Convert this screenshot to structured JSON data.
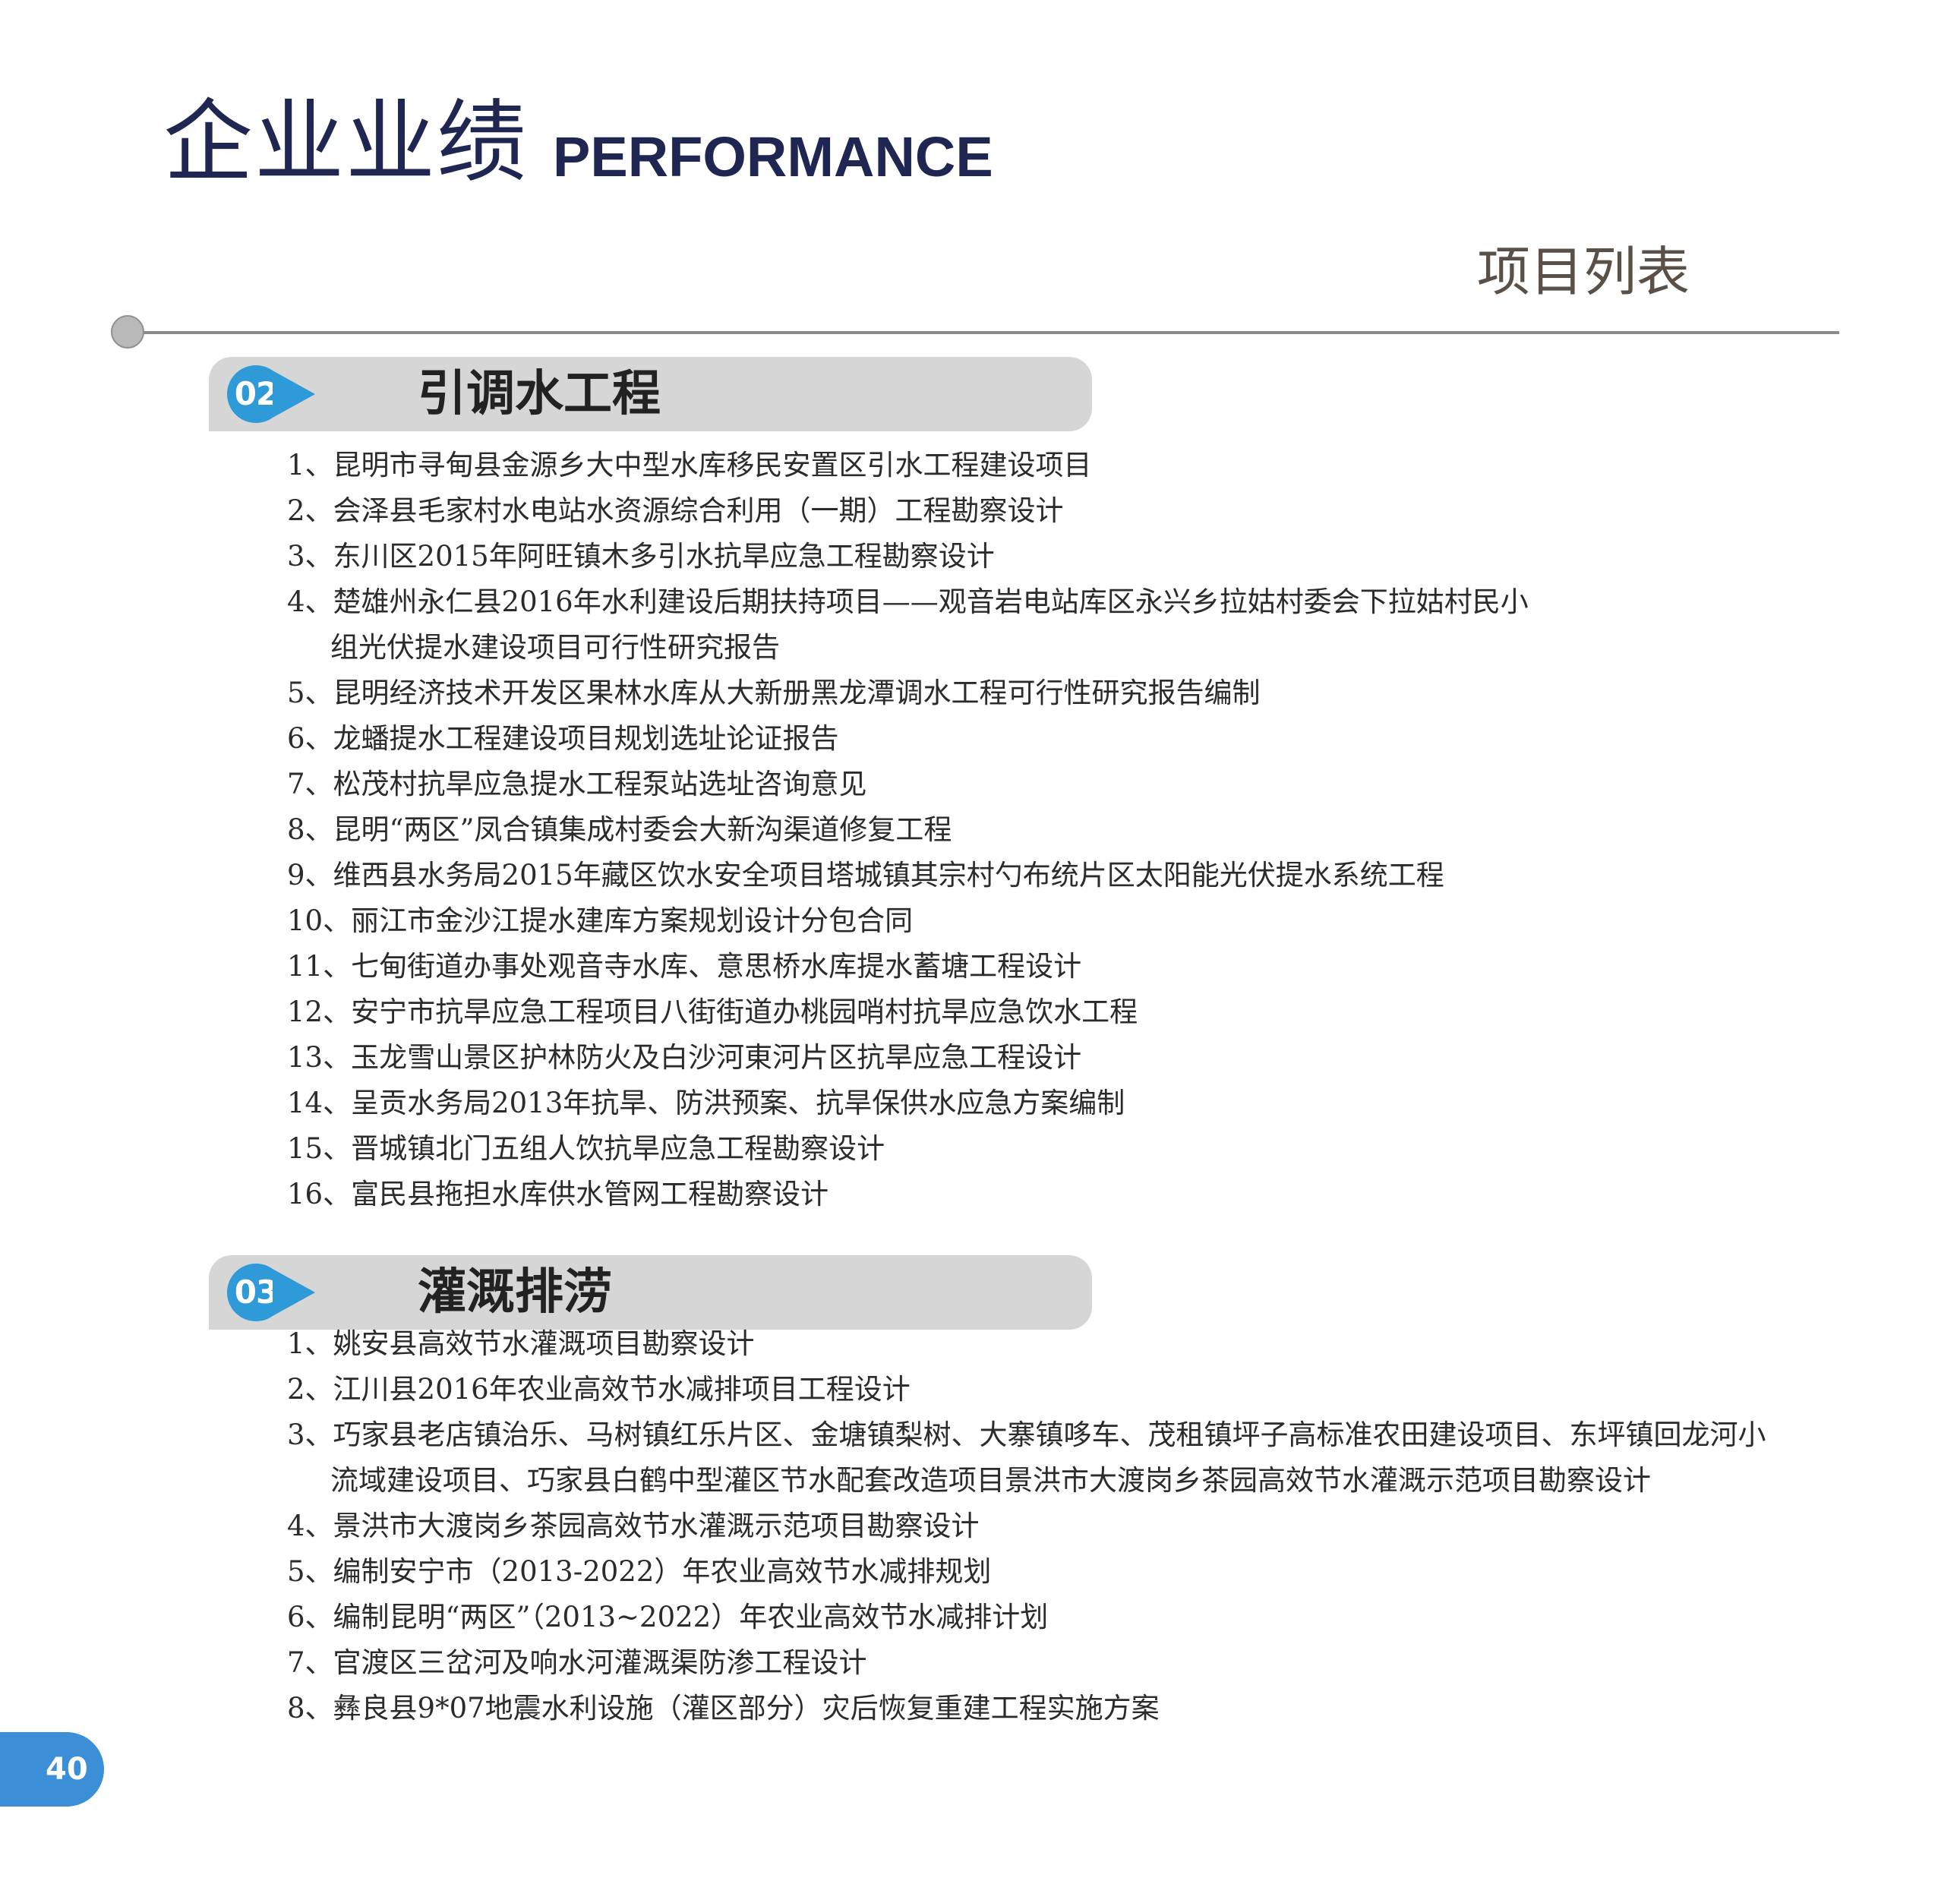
{
  "header": {
    "title_cn": "企业业绩",
    "title_en": "PERFORMANCE",
    "subtitle": "项目列表"
  },
  "sections": [
    {
      "badge": "02",
      "title": "引调水工程",
      "items": [
        {
          "num": "1、",
          "text": "昆明市寻甸县金源乡大中型水库移民安置区引水工程建设项目"
        },
        {
          "num": "2、",
          "text": "会泽县毛家村水电站水资源综合利用（一期）工程勘察设计"
        },
        {
          "num": "3、",
          "text": "东川区2015年阿旺镇木多引水抗旱应急工程勘察设计"
        },
        {
          "num": "4、",
          "text": "楚雄州永仁县2016年水利建设后期扶持项目——观音岩电站库区永兴乡拉姑村委会下拉姑村民小",
          "cont": "组光伏提水建设项目可行性研究报告"
        },
        {
          "num": "5、",
          "text": "昆明经济技术开发区果林水库从大新册黑龙潭调水工程可行性研究报告编制"
        },
        {
          "num": "6、",
          "text": "龙蟠提水工程建设项目规划选址论证报告"
        },
        {
          "num": "7、",
          "text": "松茂村抗旱应急提水工程泵站选址咨询意见"
        },
        {
          "num": "8、",
          "text": "昆明“两区”凤合镇集成村委会大新沟渠道修复工程"
        },
        {
          "num": "9、",
          "text": "维西县水务局2015年藏区饮水安全项目塔城镇其宗村勺布统片区太阳能光伏提水系统工程"
        },
        {
          "num": "10、",
          "text": "丽江市金沙江提水建库方案规划设计分包合同"
        },
        {
          "num": "11、",
          "text": "七甸街道办事处观音寺水库、意思桥水库提水蓄塘工程设计"
        },
        {
          "num": "12、",
          "text": "安宁市抗旱应急工程项目八街街道办桃园哨村抗旱应急饮水工程"
        },
        {
          "num": "13、",
          "text": "玉龙雪山景区护林防火及白沙河東河片区抗旱应急工程设计"
        },
        {
          "num": "14、",
          "text": "呈贡水务局2013年抗旱、防洪预案、抗旱保供水应急方案编制"
        },
        {
          "num": "15、",
          "text": "晋城镇北门五组人饮抗旱应急工程勘察设计"
        },
        {
          "num": "16、",
          "text": "富民县拖担水库供水管网工程勘察设计"
        }
      ]
    },
    {
      "badge": "03",
      "title": "灌溉排涝",
      "items": [
        {
          "num": "1、",
          "text": "姚安县高效节水灌溉项目勘察设计"
        },
        {
          "num": "2、",
          "text": "江川县2016年农业高效节水减排项目工程设计"
        },
        {
          "num": "3、",
          "text": "巧家县老店镇治乐、马树镇红乐片区、金塘镇梨树、大寨镇哆车、茂租镇坪子高标准农田建设项目、东坪镇回龙河小",
          "cont": "流域建设项目、巧家县白鹤中型灌区节水配套改造项目景洪市大渡岗乡茶园高效节水灌溉示范项目勘察设计"
        },
        {
          "num": "4、",
          "text": "景洪市大渡岗乡茶园高效节水灌溉示范项目勘察设计"
        },
        {
          "num": "5、",
          "text": "编制安宁市（2013-2022）年农业高效节水减排规划"
        },
        {
          "num": "6、",
          "text": "编制昆明“两区”（2013~2022）年农业高效节水减排计划"
        },
        {
          "num": "7、",
          "text": "官渡区三岔河及响水河灌溉渠防渗工程设计"
        },
        {
          "num": "8、",
          "text": "彝良县9*07地震水利设施（灌区部分）灾后恢复重建工程实施方案"
        }
      ]
    }
  ],
  "footer": {
    "page_number": "40"
  },
  "colors": {
    "title": "#1f2652",
    "badge": "#2e9ad8",
    "bar": "#d6d6d6",
    "page_tab": "#3a8fd6"
  }
}
